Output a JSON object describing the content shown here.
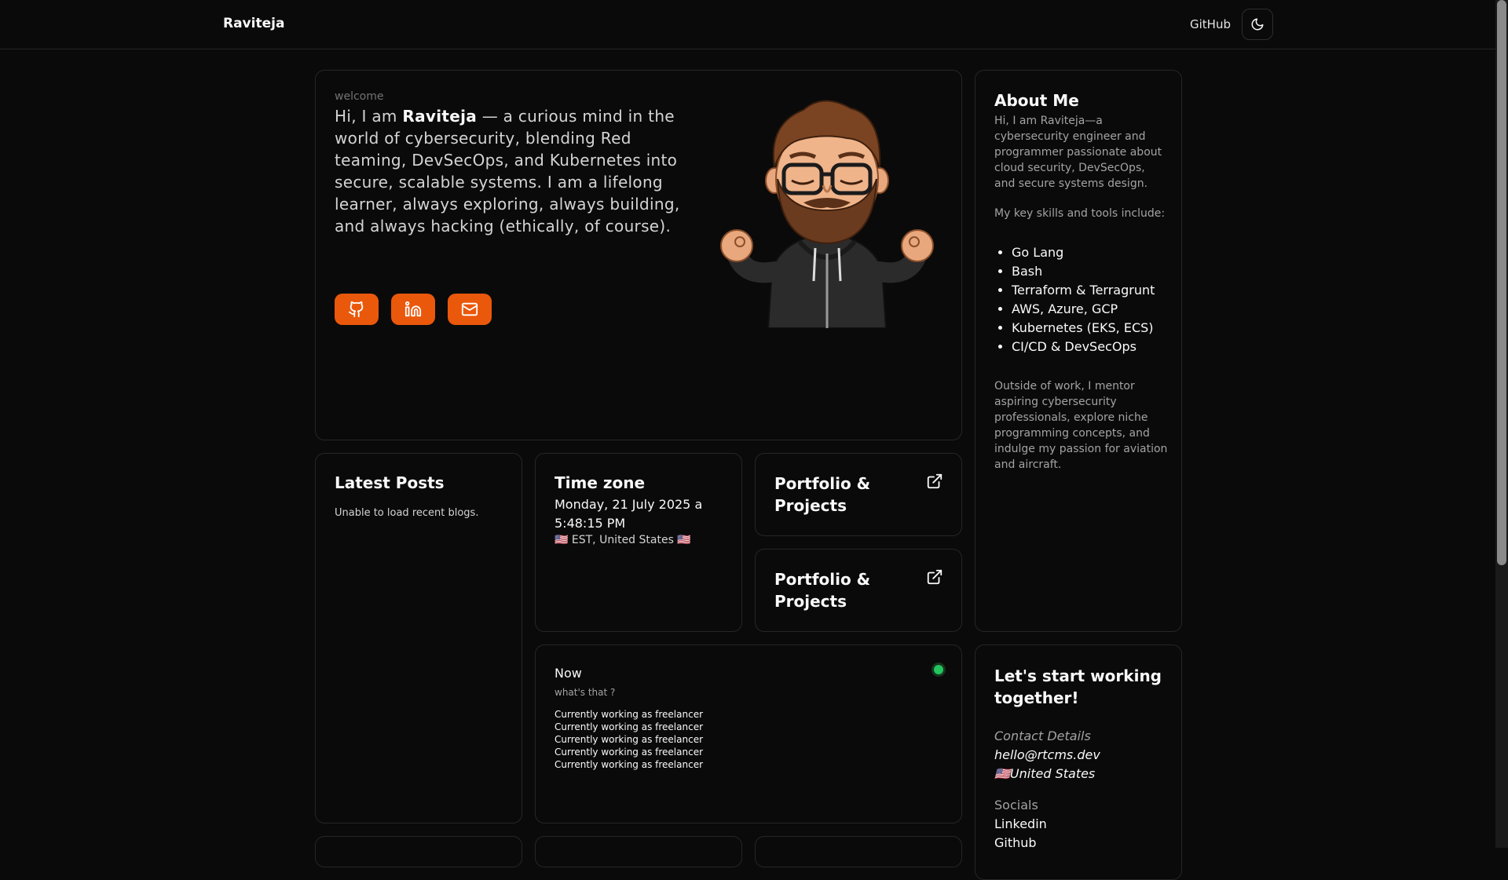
{
  "nav": {
    "brand": "Raviteja",
    "github_label": "GitHub",
    "theme_icon": "moon-icon"
  },
  "hero": {
    "welcome": "welcome",
    "intro_prefix": "Hi, I am ",
    "name": "Raviteja",
    "intro_suffix": " — a curious mind in the world of cybersecurity, blending Red teaming, DevSecOps, and Kubernetes into secure, scalable systems. I am a lifelong learner, always exploring, always building, and always hacking (ethically, of course).",
    "socials": [
      "github-icon",
      "linkedin-icon",
      "mail-icon"
    ],
    "accent": "#ea580c"
  },
  "about": {
    "title": "About Me",
    "p1": "Hi, I am Raviteja—a cybersecurity engineer and programmer passionate about cloud security, DevSecOps, and secure systems design.",
    "p2": "My key skills and tools include:",
    "skills": [
      "Go Lang",
      "Bash",
      "Terraform & Terragrunt",
      "AWS, Azure, GCP",
      "Kubernetes (EKS, ECS)",
      "CI/CD & DevSecOps"
    ],
    "p3": "Outside of work, I mentor aspiring cybersecurity professionals, explore niche programming concepts, and indulge my passion for aviation and aircraft."
  },
  "posts": {
    "title": "Latest Posts",
    "message": "Unable to load recent blogs."
  },
  "timezone": {
    "title": "Time zone",
    "datetime": "Monday, 21 July 2025 a 5:48:15 PM",
    "location": "🇺🇸 EST, United States 🇺🇸"
  },
  "portfolio": [
    {
      "title": "Portfolio & Projects",
      "icon": "external-link-icon"
    },
    {
      "title": "Portfolio & Projects",
      "icon": "external-link-icon"
    }
  ],
  "now": {
    "title": "Now",
    "subtitle": "what's that ?",
    "status_color": "#22c55e",
    "lines": [
      "Currently working as freelancer",
      "Currently working as freelancer",
      "Currently working as freelancer",
      "Currently working as freelancer",
      "Currently working as freelancer"
    ]
  },
  "contact": {
    "title": "Let's start working together!",
    "details_label": "Contact Details",
    "email": "hello@rtcms.dev",
    "country": "🇺🇸United States",
    "socials_label": "Socials",
    "socials": [
      "Linkedin",
      "Github"
    ]
  }
}
